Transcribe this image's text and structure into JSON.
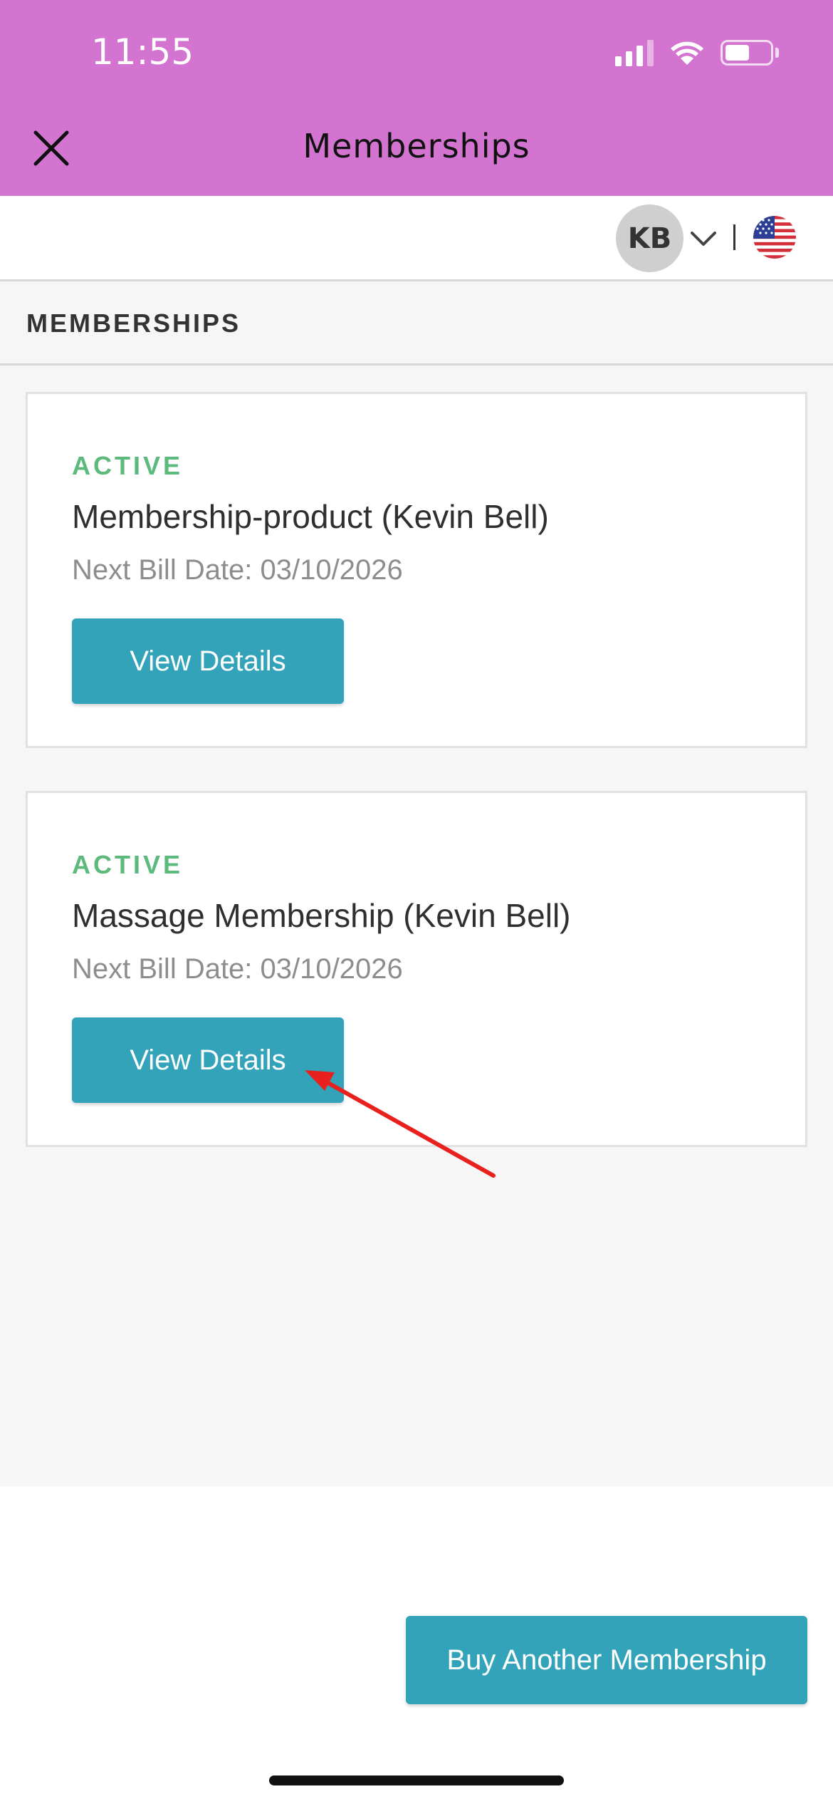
{
  "status_bar": {
    "time": "11:55",
    "battery_level": 0.55
  },
  "header": {
    "title": "Memberships",
    "close_icon": "close-icon",
    "background": "#d374d0"
  },
  "account": {
    "initials": "KB",
    "dropdown_icon": "chevron-down-icon",
    "language_icon": "us-flag-icon"
  },
  "section": {
    "title": "MEMBERSHIPS"
  },
  "memberships": [
    {
      "status": "ACTIVE",
      "name": "Membership-product (Kevin Bell)",
      "next_bill": "Next Bill Date: 03/10/2026",
      "button_label": "View Details"
    },
    {
      "status": "ACTIVE",
      "name": "Massage Membership (Kevin Bell)",
      "next_bill": "Next Bill Date: 03/10/2026",
      "button_label": "View Details"
    }
  ],
  "footer": {
    "buy_button_label": "Buy Another Membership"
  },
  "colors": {
    "accent": "#33a3b9",
    "active_status": "#5cba7d",
    "annotation_arrow": "#e8201e"
  }
}
